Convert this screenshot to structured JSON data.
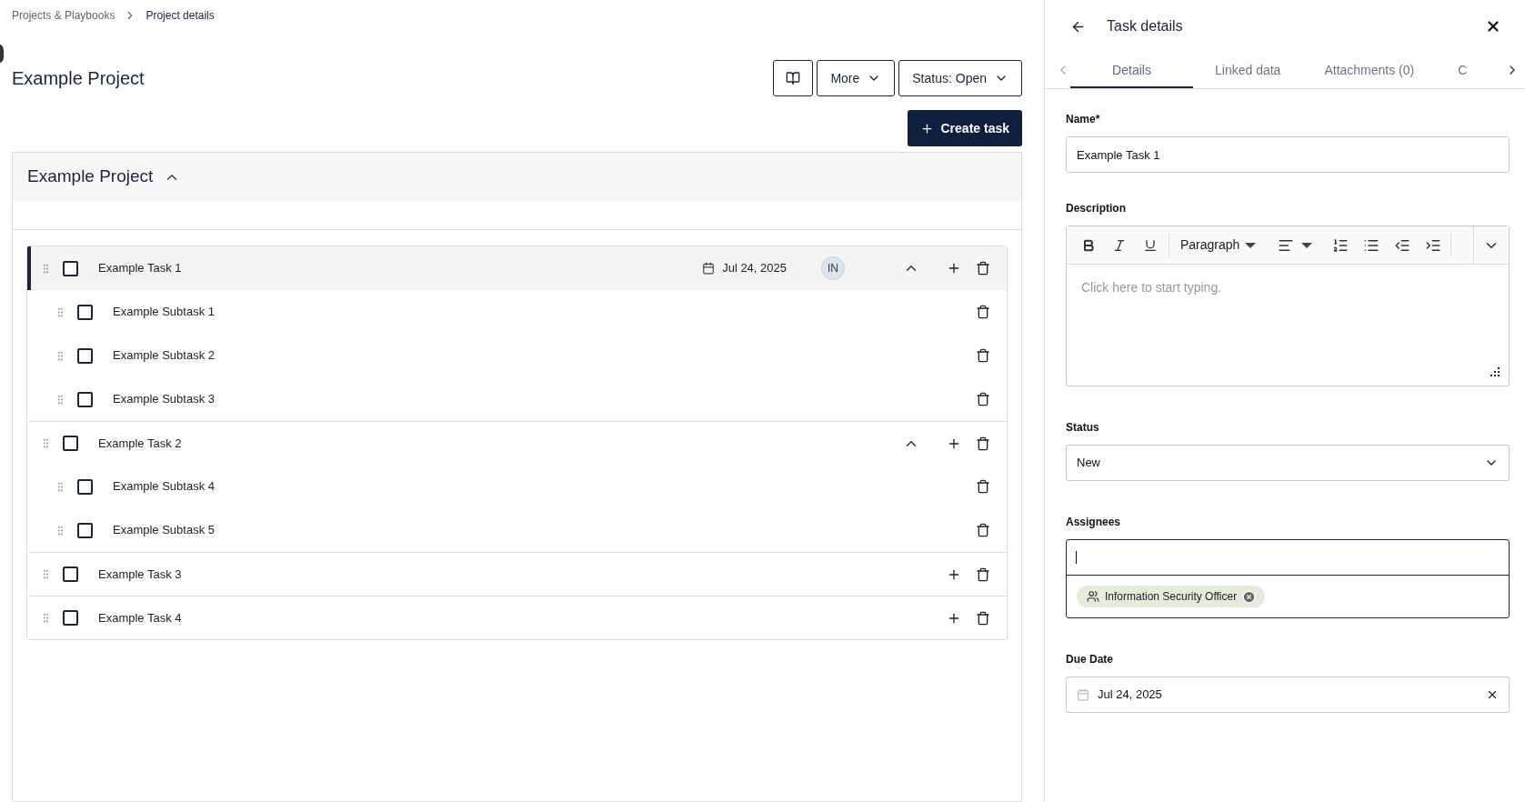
{
  "breadcrumb": [
    {
      "label": "Projects & Playbooks",
      "current": false
    },
    {
      "label": "Project details",
      "current": true
    }
  ],
  "page_title": "Example Project",
  "header_buttons": {
    "more": "More",
    "status": "Status: Open",
    "create_task": "Create task"
  },
  "project": {
    "title": "Example Project",
    "expanded": true
  },
  "tasks": [
    {
      "name": "Example Task 1",
      "selected": true,
      "checked": false,
      "date": "Jul 24, 2025",
      "assignee": "IN",
      "expanded": true,
      "children": [
        {
          "name": "Example Subtask 1",
          "checked": false
        },
        {
          "name": "Example Subtask 2",
          "checked": false
        },
        {
          "name": "Example Subtask 3",
          "checked": false
        }
      ]
    },
    {
      "name": "Example Task 2",
      "selected": false,
      "checked": false,
      "expanded": true,
      "children": [
        {
          "name": "Example Subtask 4",
          "checked": false
        },
        {
          "name": "Example Subtask 5",
          "checked": false
        }
      ]
    },
    {
      "name": "Example Task 3",
      "selected": false,
      "checked": false
    },
    {
      "name": "Example Task 4",
      "selected": false,
      "checked": false
    }
  ],
  "panel": {
    "title": "Task details",
    "tabs": [
      {
        "label": "Details",
        "selected": true
      },
      {
        "label": "Linked data",
        "selected": false
      },
      {
        "label": "Attachments (0)",
        "selected": false
      },
      {
        "label": "C",
        "selected": false
      }
    ],
    "name_label": "Name*",
    "name_value": "Example Task 1",
    "description_label": "Description",
    "paragraph_style": "Paragraph",
    "description_placeholder": "Click here to start typing.",
    "status_label": "Status",
    "status_value": "New",
    "assignees_label": "Assignees",
    "assignees": [
      {
        "name": "Information Security Officer"
      }
    ],
    "due_label": "Due Date",
    "due_value": "Jul 24, 2025"
  }
}
